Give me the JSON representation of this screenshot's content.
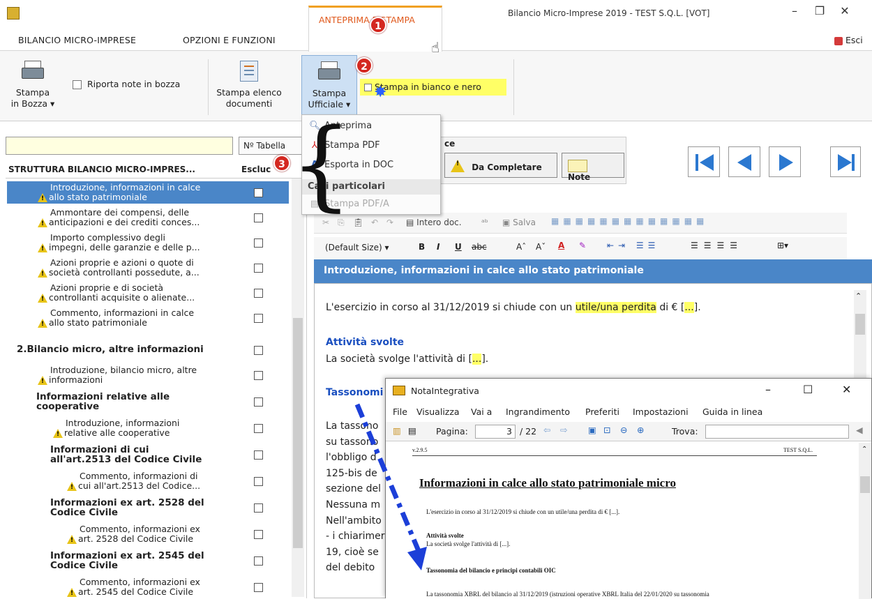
{
  "window": {
    "title": "Bilancio Micro-Imprese 2019 - TEST S.Q.L. [VOT]",
    "minimize": "–",
    "restore": "❐",
    "close": "✕"
  },
  "tabs": [
    "BILANCIO MICRO-IMPRESE",
    "OPZIONI E FUNZIONI",
    "ANTEPRIMA E STAMPA"
  ],
  "exit_label": "Esci",
  "ribbon": {
    "stampa_bozza": [
      "Stampa",
      "in Bozza ▾"
    ],
    "riporta_note": "Riporta note in bozza",
    "stampa_elenco": [
      "Stampa elenco",
      "documenti"
    ],
    "stampa_ufficiale": [
      "Stampa",
      "Ufficiale ▾"
    ],
    "bianco_nero": "Stampa in bianco e nero"
  },
  "badges": [
    "1",
    "2",
    "3"
  ],
  "dropdown": {
    "items": [
      "Anteprima",
      "Stampa PDF",
      "Esporta in DOC"
    ],
    "category": "Casi particolari",
    "disabled_item": "Stampa PDF/A"
  },
  "left": {
    "ntab_label": "Nº Tabella",
    "tree_header": "STRUTTURA BILANCIO MICRO-IMPRES...",
    "exclude_header": "Escluc",
    "rows": [
      {
        "l1": "Introduzione, informazioni in calce",
        "l2": "allo stato patrimoniale"
      },
      {
        "l1": "Ammontare dei compensi, delle",
        "l2": "anticipazioni e dei crediti conces..."
      },
      {
        "l1": "Importo complessivo degli",
        "l2": "impegni, delle garanzie e delle p..."
      },
      {
        "l1": "Azioni proprie e azioni o quote di",
        "l2": "società controllanti possedute, a..."
      },
      {
        "l1": "Azioni proprie e di società",
        "l2": "controllanti acquisite o alienate..."
      },
      {
        "l1": "Commento, informazioni in calce",
        "l2": "allo stato patrimoniale"
      },
      {
        "l1": "2.Bilancio micro, altre informazioni",
        "l2": ""
      },
      {
        "l1": "Introduzione, bilancio micro, altre",
        "l2": "informazioni"
      },
      {
        "l1": "Informazioni relative alle",
        "l2": "cooperative"
      },
      {
        "l1": "Introduzione,  informazioni",
        "l2": "relative alle cooperative"
      },
      {
        "l1": "Informazioni di cui",
        "l2": "all'art.2513 del Codice Civile"
      },
      {
        "l1": "Commento, informazioni di",
        "l2": "cui all'art.2513 del Codice..."
      },
      {
        "l1": "Informazioni ex art. 2528 del",
        "l2": "Codice Civile"
      },
      {
        "l1": "Commento, informazioni ex",
        "l2": "art. 2528 del Codice Civile"
      },
      {
        "l1": "Informazioni ex art. 2545 del",
        "l2": "Codice Civile"
      },
      {
        "l1": "Commento, informazioni ex",
        "l2": "art. 2545 del Codice Civile"
      }
    ]
  },
  "status": {
    "box_title": "ce",
    "da_completare": "Da Completare",
    "note": "Note"
  },
  "toolbar": {
    "intero_doc": "Intero doc.",
    "salva": "Salva",
    "font_size": "(Default Size)"
  },
  "section_title": "Introduzione, informazioni in calce allo stato patrimoniale",
  "editor": {
    "p1_a": "L'esercizio in corso al 31/12/2019 si chiude con un ",
    "p1_hl": "utile/una perdita",
    "p1_b": " di € [",
    "p1_dots": "...",
    "p1_c": "].",
    "h_attivita": "Attività svolte",
    "p2_a": "La società svolge l'attività di [",
    "p2_dots": "...",
    "p2_b": "].",
    "h_tassonomia": "Tassonomi",
    "lines": [
      "La tassono",
      "su tassono",
      "l'obbligo d",
      "125-bis de",
      "sezione del",
      "Nessuna m",
      "Nell'ambito",
      "- i chiarimer",
      "19, cioè se",
      "del  debito"
    ]
  },
  "nota": {
    "title": "NotaIntegrativa",
    "menu": [
      "File",
      "Visualizza",
      "Vai a",
      "Ingrandimento",
      "Preferiti",
      "Impostazioni",
      "Guida in linea"
    ],
    "pagina_label": "Pagina:",
    "page_current": "3",
    "page_total": "/ 22",
    "trova_label": "Trova:",
    "pdf": {
      "version": "v.2.9.5",
      "company": "TEST S.Q.L.",
      "heading": "Informazioni in calce allo stato patrimoniale micro",
      "p1": "L'esercizio in corso al 31/12/2019 si chiude con un utile/una perdita di € [...].",
      "h_attivita": "Attività svolte",
      "p2": "La società svolge l'attività di [...].",
      "h_tass": "Tassonomia del bilancio e principi contabili OIC",
      "p3": "La tassonomia XBRL del bilancio al 31/12/2019 (istruzioni operative XBRL Italia del 22/01/2020 su tassonomia"
    }
  }
}
